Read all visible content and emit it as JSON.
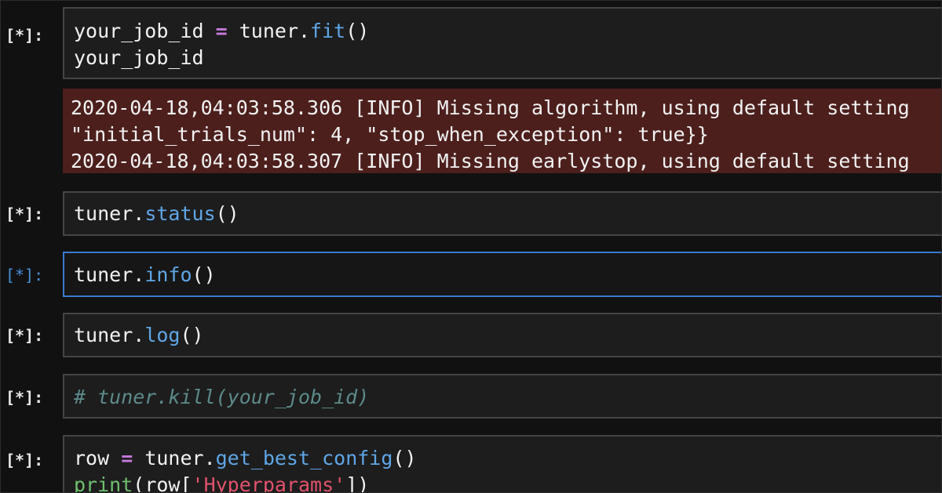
{
  "cells": [
    {
      "prompt": "[*]:",
      "lines": [
        {
          "a": "your_job_id",
          "op": " = ",
          "b": "tuner.",
          "fn": "fit",
          "c": "()"
        },
        {
          "a": "your_job_id"
        }
      ]
    },
    {
      "output_lines": [
        "2020-04-18,04:03:58.306 [INFO] Missing algorithm, using default setting",
        "\"initial_trials_num\": 4, \"stop_when_exception\": true}}",
        "2020-04-18,04:03:58.307 [INFO] Missing earlystop, using default setting"
      ]
    },
    {
      "prompt": "[*]:",
      "obj": "tuner.",
      "fn": "status",
      "tail": "()"
    },
    {
      "prompt": "[*]:",
      "obj": "tuner.",
      "fn": "info",
      "tail": "()"
    },
    {
      "prompt": "[*]:",
      "obj": "tuner.",
      "fn": "log",
      "tail": "()"
    },
    {
      "prompt": "[*]:",
      "comment": "# tuner.kill(your_job_id)"
    },
    {
      "prompt": "[*]:",
      "line1": {
        "a": "row",
        "op": " = ",
        "b": "tuner.",
        "fn": "get_best_config",
        "c": "()"
      },
      "line2": {
        "builtin": "print",
        "a": "(row[",
        "str": "'Hyperparams'",
        "b": "])"
      }
    }
  ],
  "colors": {
    "background": "#111111",
    "cell_background": "#1d1d1d",
    "cell_border": "#454545",
    "selected_border": "#3a7bd0",
    "error_output_background": "#4c1f1d",
    "operator": "#c678dd",
    "function": "#5fa6e6",
    "string": "#e0526c",
    "builtin": "#6fbf6f",
    "comment": "#5d8a8a"
  }
}
